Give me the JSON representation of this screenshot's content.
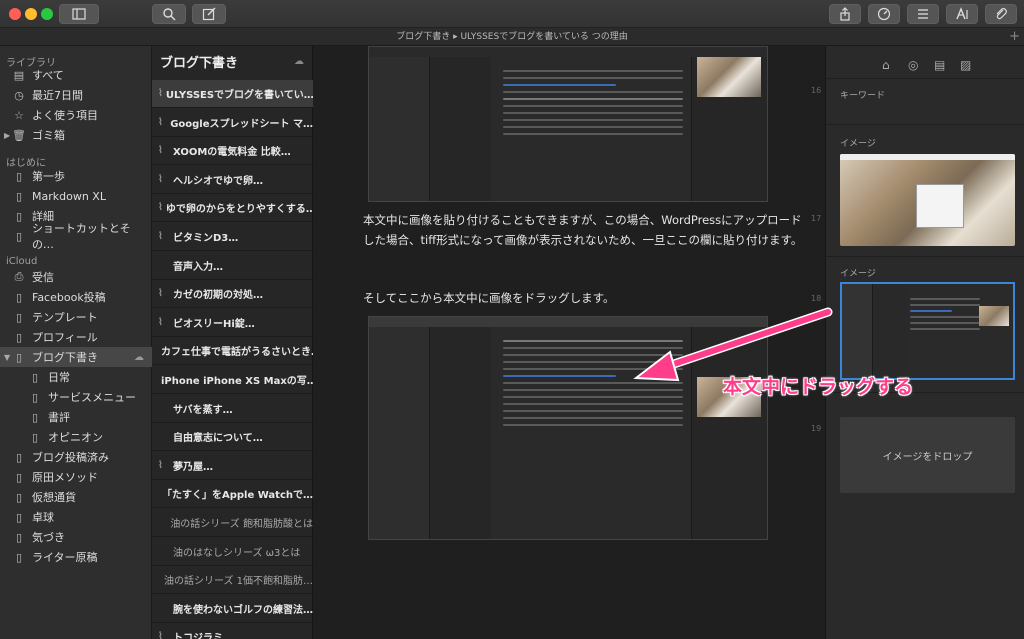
{
  "window": {
    "doc_title": "ブログ下書き ▸ ULYSSESでブログを書いている つの理由"
  },
  "sidebar": {
    "library_header": "ライブラリ",
    "library": [
      {
        "label": "すべて",
        "icon": "stack-icon"
      },
      {
        "label": "最近7日間",
        "icon": "clock-icon"
      },
      {
        "label": "よく使う項目",
        "icon": "star-icon"
      },
      {
        "label": "ゴミ箱",
        "icon": "trash-icon"
      }
    ],
    "start_header": "はじめに",
    "start": [
      {
        "label": "第一歩"
      },
      {
        "label": "Markdown XL"
      },
      {
        "label": "詳細"
      },
      {
        "label": "ショートカットとその…"
      }
    ],
    "icloud_header": "iCloud",
    "icloud": [
      {
        "label": "受信"
      },
      {
        "label": "Facebook投稿"
      },
      {
        "label": "テンプレート"
      },
      {
        "label": "プロフィール"
      },
      {
        "label": "ブログ下書き"
      },
      {
        "label": "日常"
      },
      {
        "label": "サービスメニュー"
      },
      {
        "label": "書評"
      },
      {
        "label": "オピニオン"
      },
      {
        "label": "ブログ投稿済み"
      },
      {
        "label": "原田メソッド"
      },
      {
        "label": "仮想通貨"
      },
      {
        "label": "卓球"
      },
      {
        "label": "気づき"
      },
      {
        "label": "ライター原稿"
      }
    ]
  },
  "sheets": {
    "header": "ブログ下書き",
    "items": [
      {
        "title": "ULYSSESでブログを書いてい…",
        "attach": true
      },
      {
        "title": "Googleスプレッドシート マ…",
        "attach": true
      },
      {
        "title": "XOOMの電気料金 比較…",
        "attach": true
      },
      {
        "title": "ヘルシオでゆで卵…",
        "attach": true
      },
      {
        "title": "ゆで卵のからをとりやすくする…",
        "attach": true
      },
      {
        "title": "ビタミンD3…",
        "attach": true
      },
      {
        "title": "音声入力…",
        "attach": false
      },
      {
        "title": "カゼの初期の対処…",
        "attach": true
      },
      {
        "title": "ビオスリーHi錠…",
        "attach": true
      },
      {
        "title": "カフェ仕事で電話がうるさいとき…",
        "attach": false
      },
      {
        "title": "iPhone iPhone XS Maxの写…",
        "attach": false
      },
      {
        "title": "サバを蒸す…",
        "attach": false
      },
      {
        "title": "自由意志について…",
        "attach": false
      },
      {
        "title": "夢乃屋…",
        "attach": true
      },
      {
        "title": "「たすく」をApple Watchで…",
        "attach": false
      },
      {
        "title": "油の話シリーズ 飽和脂肪酸とは",
        "attach": false
      },
      {
        "title": "油のはなしシリーズ ω3とは",
        "attach": false
      },
      {
        "title": "油の話シリーズ 1価不飽和脂肪…",
        "attach": false
      },
      {
        "title": "腕を使わないゴルフの練習法…",
        "attach": false
      },
      {
        "title": "トコジラミ…",
        "attach": true
      }
    ]
  },
  "editor": {
    "para1": "本文中に画像を貼り付けることもできますが、この場合、WordPressにアップロードした場合、tiff形式になって画像が表示されないため、一旦ここの欄に貼り付けます。",
    "para2": "そしてここから本文中に画像をドラッグします。",
    "line_numbers": [
      "16",
      "17",
      "18",
      "19"
    ]
  },
  "right_pane": {
    "keyword_header": "キーワード",
    "image_header1": "イメージ",
    "image_header2": "イメージ",
    "drop_label": "イメージをドロップ"
  },
  "annotation": "本文中にドラッグする",
  "colors": {
    "accent": "#3a86d8",
    "annotation": "#ff3d8b"
  }
}
